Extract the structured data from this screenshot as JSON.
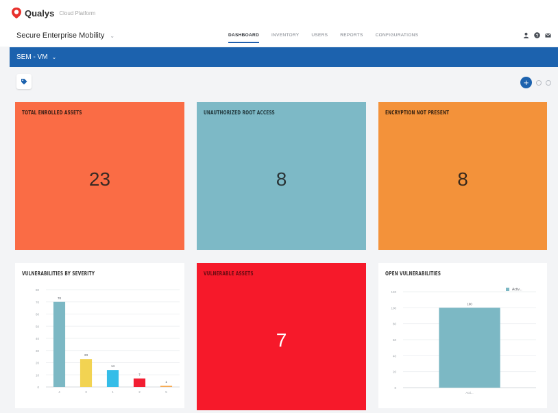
{
  "header": {
    "brand": "Qualys",
    "brand_sub": "Cloud Platform",
    "app_name": "Secure Enterprise Mobility",
    "nav_tabs": [
      {
        "label": "DASHBOARD",
        "active": true
      },
      {
        "label": "INVENTORY",
        "active": false
      },
      {
        "label": "USERS",
        "active": false
      },
      {
        "label": "REPORTS",
        "active": false
      },
      {
        "label": "CONFIGURATIONS",
        "active": false
      }
    ],
    "icons": [
      "user-icon",
      "help-icon",
      "mail-icon"
    ]
  },
  "subbar": {
    "dashboard_name": "SEM - VM"
  },
  "toolbar": {
    "tag_icon": "tag-icon",
    "add_icon": "plus-icon",
    "refresh_icon": "refresh-icon",
    "settings_icon": "settings-icon"
  },
  "widgets": {
    "total_enrolled": {
      "title": "TOTAL ENROLLED ASSETS",
      "value": "23",
      "color": "#fa6c45"
    },
    "unauthorized_root": {
      "title": "UNAUTHORIZED ROOT ACCESS",
      "value": "8",
      "color": "#7db9c6"
    },
    "encryption": {
      "title": "ENCRYPTION NOT PRESENT",
      "value": "8",
      "color": "#f3923a"
    },
    "vuln_severity": {
      "title": "VULNERABILITIES BY SEVERITY"
    },
    "vulnerable_assets": {
      "title": "VULNERABLE ASSETS",
      "value": "7",
      "color": "#f6192a"
    },
    "open_vulns": {
      "title": "OPEN VULNERABILITIES"
    }
  },
  "chart_data": [
    {
      "type": "bar",
      "title": "VULNERABILITIES BY SEVERITY",
      "categories": [
        "4",
        "3",
        "1",
        "2",
        "5"
      ],
      "values": [
        70,
        23,
        14,
        7,
        1
      ],
      "colors": [
        "#7cb8c4",
        "#f2d352",
        "#35bde8",
        "#f21e32",
        "#f6a84e"
      ],
      "y_ticks": [
        "0",
        "10",
        "20",
        "30",
        "40",
        "50",
        "60",
        "70",
        "80"
      ],
      "ylim": [
        0,
        80
      ],
      "grid": true
    },
    {
      "type": "bar",
      "title": "OPEN VULNERABILITIES",
      "categories": [
        "Acti..."
      ],
      "values": [
        100
      ],
      "colors": [
        "#7cb8c4"
      ],
      "legend": [
        "Activ..."
      ],
      "legend_position": "top-right",
      "y_ticks": [
        "0",
        "20",
        "40",
        "60",
        "80",
        "100",
        "120"
      ],
      "ylim": [
        0,
        120
      ],
      "grid": true
    }
  ]
}
